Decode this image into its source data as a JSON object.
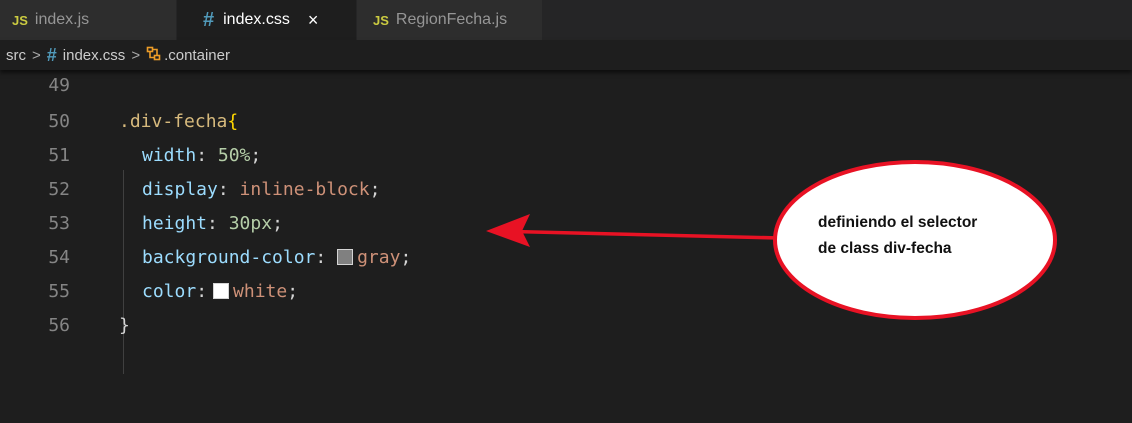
{
  "tabs": [
    {
      "icon": "JS",
      "label": "index.js",
      "active": false
    },
    {
      "icon": "#",
      "label": "index.css",
      "active": true,
      "close": "×"
    },
    {
      "icon": "JS",
      "label": "RegionFecha.js",
      "active": false
    }
  ],
  "breadcrumb": {
    "folder": "src",
    "separator": ">",
    "file_icon": "#",
    "file": "index.css",
    "symbol_icon": "selector-symbol-icon",
    "symbol": ".container"
  },
  "code": {
    "lines": [
      {
        "number": "49"
      },
      {
        "number": "50",
        "selector": ".div-fecha",
        "brace": "{"
      },
      {
        "number": "51",
        "property": "width",
        "colon": ":",
        "value": "50%",
        "semi": ";"
      },
      {
        "number": "52",
        "property": "display",
        "colon": ":",
        "value": "inline-block",
        "semi": ";"
      },
      {
        "number": "53",
        "property": "height",
        "colon": ":",
        "value": "30px",
        "semi": ";"
      },
      {
        "number": "54",
        "property": "background-color",
        "colon": ":",
        "value": "gray",
        "semi": ";",
        "swatch": "#808080"
      },
      {
        "number": "55",
        "property": "color",
        "colon": ":",
        "value": "white",
        "semi": ";",
        "swatch": "#ffffff"
      },
      {
        "number": "56",
        "brace": "}"
      }
    ]
  },
  "annotation": {
    "line1": "definiendo el selector",
    "line2": "de class div-fecha",
    "arrow_color": "#e81224",
    "bubble_fill": "#ffffff",
    "bubble_stroke": "#e81224"
  },
  "colors": {
    "editor_bg": "#1e1e1e",
    "tab_inactive_bg": "#2d2d2d",
    "js_icon": "#cbcb41",
    "css_icon": "#519aba",
    "selector": "#d7ba7d",
    "property": "#9cdcfe",
    "number": "#b5cea8",
    "string_value": "#ce9178"
  }
}
